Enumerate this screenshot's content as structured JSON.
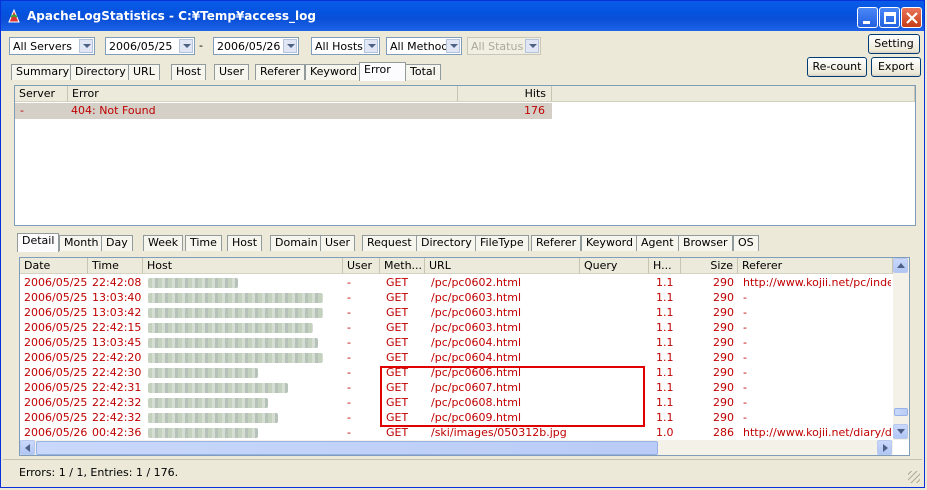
{
  "window": {
    "title": "ApacheLogStatistics - C:¥Temp¥access_log"
  },
  "filters": {
    "server": "All Servers",
    "date_from": "2006/05/25",
    "separator": "-",
    "date_to": "2006/05/26",
    "hosts": "All Hosts",
    "method": "All Method",
    "status": "All Status"
  },
  "buttons": {
    "setting": "Setting",
    "recount": "Re-count",
    "export": "Export"
  },
  "top_tabs": [
    "Summary",
    "Directory",
    "URL",
    "Host",
    "User",
    "Referer",
    "Keyword",
    "Error",
    "Total"
  ],
  "top_tabs_selected": "Error",
  "error_table": {
    "columns": [
      "Server",
      "Error",
      "Hits"
    ],
    "rows": [
      {
        "server": "-",
        "error": "404: Not Found",
        "hits": "176"
      }
    ]
  },
  "detail_tabs": [
    "Detail",
    "Month",
    "Day",
    "Week",
    "Time",
    "Host",
    "Domain",
    "User",
    "Request",
    "Directory",
    "FileType",
    "Referer",
    "Keyword",
    "Agent",
    "Browser",
    "OS"
  ],
  "detail_tabs_selected": "Detail",
  "detail_table": {
    "columns": [
      "Date",
      "Time",
      "Host",
      "User",
      "Meth...",
      "URL",
      "Query",
      "H...",
      "Size",
      "Referer"
    ],
    "rows": [
      {
        "date": "2006/05/25",
        "time": "22:42:08",
        "user": "-",
        "method": "GET",
        "url": "/pc/pc0602.html",
        "query": "",
        "http": "1.1",
        "size": "290",
        "referer": "http://www.kojii.net/pc/index"
      },
      {
        "date": "2006/05/25",
        "time": "13:03:40",
        "user": "-",
        "method": "GET",
        "url": "/pc/pc0603.html",
        "query": "",
        "http": "1.1",
        "size": "290",
        "referer": "-"
      },
      {
        "date": "2006/05/25",
        "time": "13:03:42",
        "user": "-",
        "method": "GET",
        "url": "/pc/pc0603.html",
        "query": "",
        "http": "1.1",
        "size": "290",
        "referer": "-"
      },
      {
        "date": "2006/05/25",
        "time": "22:42:15",
        "user": "-",
        "method": "GET",
        "url": "/pc/pc0603.html",
        "query": "",
        "http": "1.1",
        "size": "290",
        "referer": "-"
      },
      {
        "date": "2006/05/25",
        "time": "13:03:45",
        "user": "-",
        "method": "GET",
        "url": "/pc/pc0604.html",
        "query": "",
        "http": "1.1",
        "size": "290",
        "referer": "-"
      },
      {
        "date": "2006/05/25",
        "time": "22:42:20",
        "user": "-",
        "method": "GET",
        "url": "/pc/pc0604.html",
        "query": "",
        "http": "1.1",
        "size": "290",
        "referer": "-"
      },
      {
        "date": "2006/05/25",
        "time": "22:42:30",
        "user": "-",
        "method": "GET",
        "url": "/pc/pc0606.html",
        "query": "",
        "http": "1.1",
        "size": "290",
        "referer": "-"
      },
      {
        "date": "2006/05/25",
        "time": "22:42:31",
        "user": "-",
        "method": "GET",
        "url": "/pc/pc0607.html",
        "query": "",
        "http": "1.1",
        "size": "290",
        "referer": "-"
      },
      {
        "date": "2006/05/25",
        "time": "22:42:32",
        "user": "-",
        "method": "GET",
        "url": "/pc/pc0608.html",
        "query": "",
        "http": "1.1",
        "size": "290",
        "referer": "-"
      },
      {
        "date": "2006/05/25",
        "time": "22:42:32",
        "user": "-",
        "method": "GET",
        "url": "/pc/pc0609.html",
        "query": "",
        "http": "1.1",
        "size": "290",
        "referer": "-"
      },
      {
        "date": "2006/05/26",
        "time": "00:42:36",
        "user": "-",
        "method": "GET",
        "url": "/ski/images/050312b.jpg",
        "query": "",
        "http": "1.0",
        "size": "286",
        "referer": "http://www.kojii.net/diary/di"
      }
    ]
  },
  "status_bar": {
    "text": "Errors: 1 / 1,  Entries: 1 / 176."
  },
  "colors": {
    "row_text": "#c00000",
    "highlight_box": "#e00000",
    "title_bar": "#0a4fd6"
  }
}
